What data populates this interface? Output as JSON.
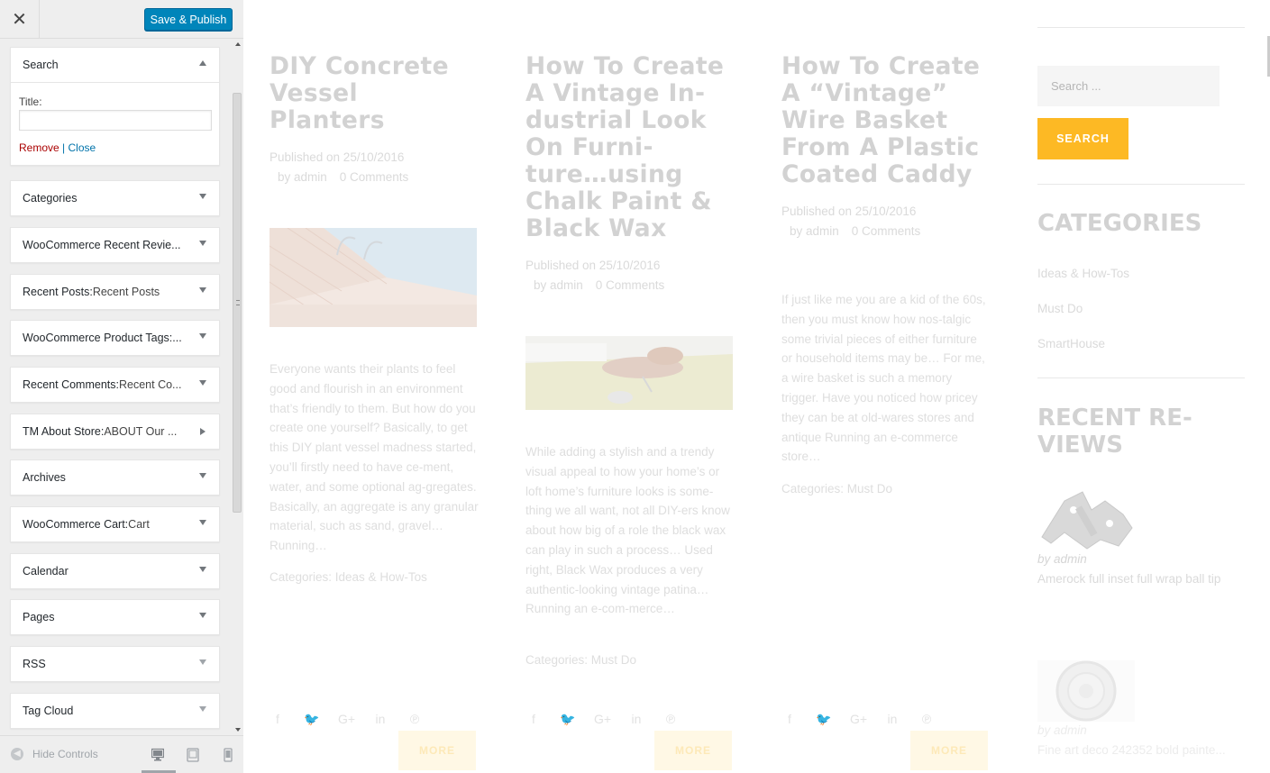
{
  "customizer": {
    "close_label": "✕",
    "publish_label": "Save & Publish",
    "search_widget": {
      "title": "Search",
      "field_label": "Title:",
      "field_value": "",
      "remove_label": "Remove",
      "separator": "|",
      "close_label": "Close"
    },
    "widgets": [
      {
        "title": "Categories",
        "sub": ""
      },
      {
        "title": "WooCommerce Recent Revie...",
        "sub": ""
      },
      {
        "title": "Recent Posts:",
        "sub": " Recent Posts"
      },
      {
        "title": "WooCommerce Product Tags:...",
        "sub": ""
      },
      {
        "title": "Recent Comments:",
        "sub": " Recent Co..."
      },
      {
        "title": "TM About Store:",
        "sub": " ABOUT Our ..."
      },
      {
        "title": "Archives",
        "sub": ""
      },
      {
        "title": "WooCommerce Cart:",
        "sub": " Cart"
      },
      {
        "title": "Calendar",
        "sub": ""
      },
      {
        "title": "Pages",
        "sub": ""
      },
      {
        "title": "RSS",
        "sub": ""
      },
      {
        "title": "Tag Cloud",
        "sub": ""
      }
    ],
    "footer": {
      "hide_label": "Hide Controls",
      "devices": [
        "desktop-icon",
        "tablet-icon",
        "mobile-icon"
      ],
      "active_device": "desktop"
    }
  },
  "preview": {
    "posts": [
      {
        "title": "DIY Concrete Vessel Planters",
        "published": "Published on 25/10/2016",
        "author": "by admin",
        "comments": "0 Comments",
        "excerpt": "Everyone wants their plants to feel good and flourish in an environment that’s friendly to them. But how do you create one yourself? Basically, to get this DIY plant vessel madness started, you’ll firstly need to have ce-ment, water, and some optional ag-gregates. Basically, an aggregate is any granular material, such as sand, gravel… Running…",
        "categories": "Categories: Ideas & How-Tos",
        "more": "MORE"
      },
      {
        "title": "How To Create A Vintage In-dustrial Look On Furni-ture…using Chalk Paint & Black Wax",
        "published": "Published on 25/10/2016",
        "author": "by admin",
        "comments": "0 Comments",
        "excerpt": "While adding a stylish and a trendy visual appeal to how your home’s or loft home’s furniture looks is some-thing we all want, not all DIY-ers know about how big of a role the black wax can play in such a process… Used right, Black Wax produces a very authentic-looking vintage patina… Running an e-com-merce…",
        "categories": "Categories: Must Do",
        "more": "MORE"
      },
      {
        "title": "How To Create A “Vintage” Wire Basket From A Plastic Coated Caddy",
        "published": "Published on 25/10/2016",
        "author": "by admin",
        "comments": "0 Comments",
        "excerpt": "If just like me you are a kid of the 60s, then you must know how nos-talgic some trivial pieces of either furniture or household items may be… For me, a wire basket is such a memory trigger. Have you noticed how pricey they can be at old-wares stores and antique Running an e-commerce store…",
        "categories": "Categories: Must Do",
        "more": "MORE"
      }
    ],
    "social_icons": [
      "f",
      "🐦",
      "G+",
      "in",
      "℗"
    ],
    "sidebar": {
      "search_placeholder": "Search ...",
      "search_button": "SEARCH",
      "categories_heading": "CATEGORIES",
      "categories": [
        "Ideas & How-Tos",
        "Must Do",
        "SmartHouse"
      ],
      "reviews_heading": "RECENT RE-VIEWS",
      "reviews": [
        {
          "by": "by admin",
          "title": "Amerock full inset full wrap ball tip"
        },
        {
          "by": "by admin",
          "title": "Fine art deco 242352 bold painte..."
        }
      ]
    },
    "colors": {
      "accent": "#fdb924",
      "publish_button": "#0085ba",
      "remove_link": "#aa0000",
      "link": "#0073aa"
    }
  }
}
